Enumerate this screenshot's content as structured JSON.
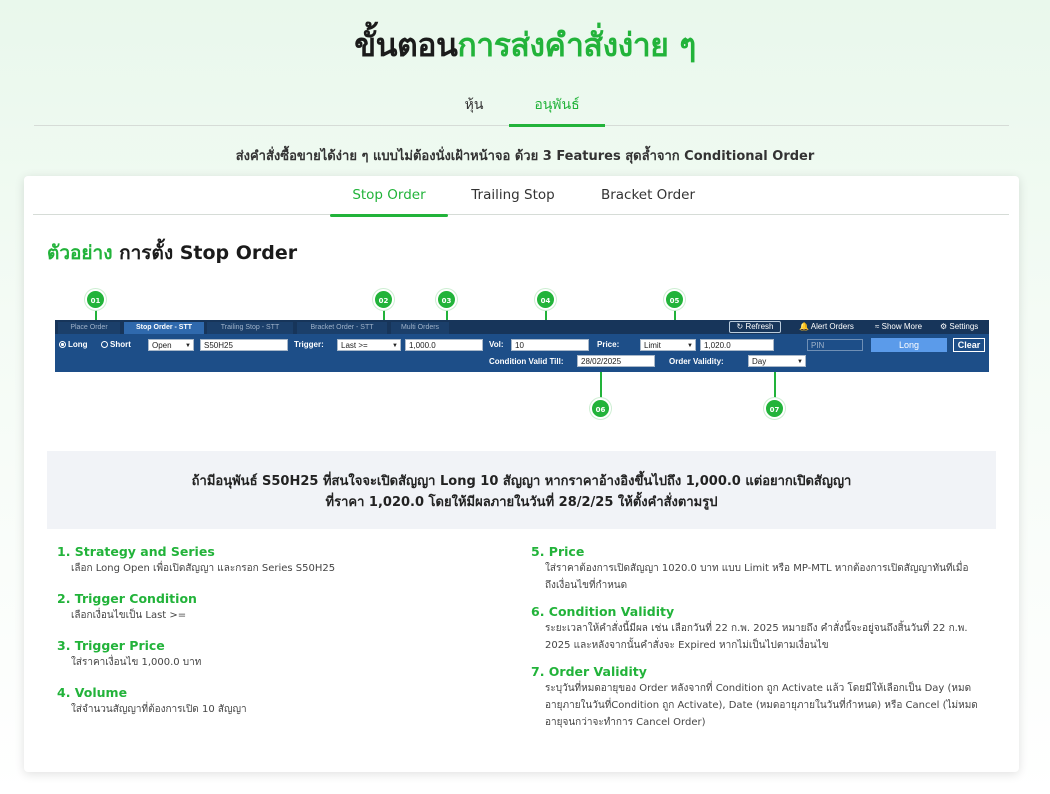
{
  "hero": {
    "title_dark": "ขั้นตอน",
    "title_green": "การส่งคำสั่งง่าย ๆ"
  },
  "main_tabs": [
    {
      "label": "หุ้น"
    },
    {
      "label": "อนุพันธ์"
    }
  ],
  "subtitle": "ส่งคำสั่งซื้อขายได้ง่าย ๆ แบบไม่ต้องนั่งเฝ้าหน้าจอ ด้วย 3 Features สุดล้ำจาก Conditional Order",
  "feature_tabs": [
    {
      "label": "Stop Order"
    },
    {
      "label": "Trailing Stop"
    },
    {
      "label": "Bracket Order"
    }
  ],
  "example": {
    "prefix": "ตัวอย่าง",
    "title": "การตั้ง Stop Order"
  },
  "markers": [
    "01",
    "02",
    "03",
    "04",
    "05",
    "06",
    "07"
  ],
  "trade_bar": {
    "tabs": [
      "Place Order",
      "Stop Order - STT",
      "Trailing Stop - STT",
      "Bracket Order - STT",
      "Multi Orders"
    ],
    "refresh": "↻ Refresh",
    "alert_orders": "🔔 Alert Orders",
    "show_more": "≈ Show More",
    "settings": "⚙ Settings",
    "long_label": "Long",
    "short_label": "Short",
    "side_value": "Open",
    "series_value": "S50H25",
    "trigger_label": "Trigger:",
    "trigger_value": "Last >=",
    "trigger_price": "1,000.0",
    "vol_label": "Vol:",
    "vol_value": "10",
    "price_label": "Price:",
    "price_type": "Limit",
    "price_value": "1,020.0",
    "pin_placeholder": "PIN",
    "long_button": "Long",
    "clear_button": "Clear",
    "valid_till_label": "Condition Valid Till:",
    "valid_till_value": "28/02/2025",
    "validity_label": "Order Validity:",
    "validity_value": "Day"
  },
  "scenario": {
    "line1": "ถ้ามีอนุพันธ์ S50H25 ที่สนใจจะเปิดสัญญา Long 10 สัญญา หากราคาอ้างอิงขึ้นไปถึง 1,000.0 แต่อยากเปิดสัญญา",
    "line2": "ที่ราคา 1,020.0 โดยให้มีผลภายในวันที่ 28/2/25 ให้ตั้งคำสั่งตามรูป"
  },
  "steps_left": [
    {
      "title": "1. Strategy and Series",
      "desc": [
        "เลือก Long Open เพื่อเปิดสัญญา และกรอก Series S50H25"
      ]
    },
    {
      "title": "2. Trigger Condition",
      "desc": [
        "เลือกเงื่อนไขเป็น Last >="
      ]
    },
    {
      "title": "3. Trigger Price",
      "desc": [
        "ใส่ราคาเงื่อนไข 1,000.0 บาท"
      ]
    },
    {
      "title": "4. Volume",
      "desc": [
        "ใส่จำนวนสัญญาที่ต้องการเปิด 10 สัญญา"
      ]
    }
  ],
  "steps_right": [
    {
      "title": "5. Price",
      "desc": [
        "ใส่ราคาต้องการเปิดสัญญา 1020.0 บาท แบบ Limit หรือ MP-MTL หากต้องการเปิดสัญญาทันทีเมื่อ",
        "ถึงเงื่อนไขที่กำหนด"
      ]
    },
    {
      "title": "6. Condition Validity",
      "desc": [
        "ระยะเวลาให้คำสั่งนี้มีผล เช่น เลือกวันที่ 22 ก.พ. 2025 หมายถึง คำสั่งนี้จะอยู่จนถึงสิ้นวันที่ 22 ก.พ.",
        "2025 และหลังจากนั้นคำสั่งจะ Expired หากไม่เป็นไปตามเงื่อนไข"
      ]
    },
    {
      "title": "7. Order Validity",
      "desc": [
        "ระบุวันที่หมดอายุของ Order หลังจากที่ Condition ถูก Activate แล้ว โดยมีให้เลือกเป็น Day (หมด",
        "อายุภายในวันที่Condition ถูก Activate), Date (หมดอายุภายในวันที่กำหนด) หรือ Cancel (ไม่หมด",
        "อายุจนกว่าจะทำการ Cancel Order)"
      ]
    }
  ],
  "colors": {
    "accent": "#22b33a",
    "bar": "#1d4e88",
    "button_blue": "#5b9bea"
  }
}
